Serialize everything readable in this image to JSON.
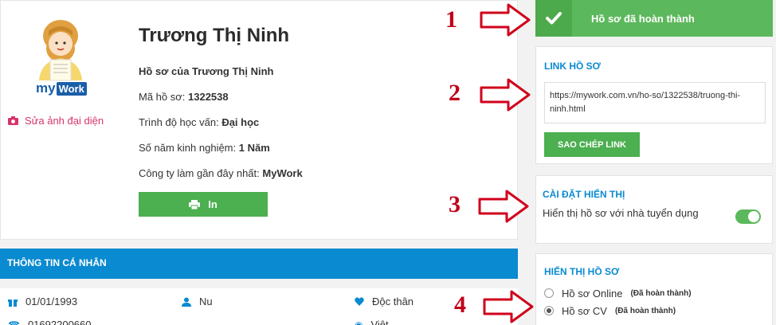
{
  "profile": {
    "name": "Trương Thị Ninh",
    "profile_of_label": "Hồ sơ của Trương Thị Ninh",
    "code_label": "Mã hồ sơ:",
    "code_value": "1322538",
    "education_label": "Trình độ học vấn:",
    "education_value": "Đại học",
    "experience_label": "Số năm kinh nghiệm:",
    "experience_value": "1 Năm",
    "company_label": "Công ty làm gần đây nhất:",
    "company_value": "MyWork",
    "edit_avatar": "Sửa ảnh đại diện",
    "print_label": "In",
    "logo_text_my": "my",
    "logo_text_work": "Work"
  },
  "personal": {
    "title": "THÔNG TIN CÁ NHÂN",
    "birthday": "01/01/1993",
    "gender": "Nu",
    "marital": "Độc thân",
    "phone_partial": "01692200660",
    "country_partial": "Việt"
  },
  "sidebar": {
    "status": "Hồ sơ đã hoàn thành",
    "link_title": "LINK HỒ SƠ",
    "link_url": "https://mywork.com.vn/ho-so/1322538/truong-thi-ninh.html",
    "copy_label": "SAO CHÉP LINK",
    "display_title": "CÀI ĐẶT HIỂN THỊ",
    "display_text": "Hiển thị hồ sơ với nhà tuyển dụng",
    "display_on": true,
    "show_title": "HIỂN THỊ HỒ SƠ",
    "options": [
      {
        "label": "Hồ sơ Online",
        "note": "(Đã hoàn thành)",
        "selected": false
      },
      {
        "label": "Hồ sơ CV",
        "note": "(Đã hoàn thành)",
        "selected": true
      }
    ]
  },
  "annotations": [
    "1",
    "2",
    "3",
    "4"
  ],
  "colors": {
    "accent_blue": "#0a8ad0",
    "green": "#5cb85c",
    "annotation_red": "#c0001a"
  }
}
